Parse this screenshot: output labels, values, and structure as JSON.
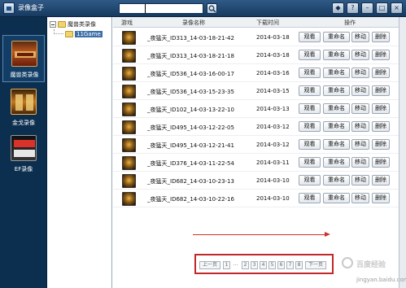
{
  "window": {
    "title": "录像盒子",
    "buttons": [
      "◆",
      "?",
      "–",
      "□",
      "×"
    ]
  },
  "search": {
    "value": ""
  },
  "categories": [
    {
      "label": "魔兽类录像",
      "icon": "warcraft-icon"
    },
    {
      "label": "金戈录像",
      "icon": "jinge-icon"
    },
    {
      "label": "EF录像",
      "icon": "ef-icon"
    }
  ],
  "tree": {
    "root": "魔兽类录像",
    "child": "11Game"
  },
  "table": {
    "headers": {
      "game": "游戏",
      "name": "录像名称",
      "date": "下载时间",
      "actions": "操作"
    },
    "action_labels": {
      "watch": "观看",
      "rename": "重命名",
      "move": "移动",
      "delete": "删除"
    },
    "rows": [
      {
        "name": "_夜猛天_ID313_14-03-18-21-42",
        "date": "2014-03-18"
      },
      {
        "name": "_夜猛天_ID313_14-03-18-21-18",
        "date": "2014-03-18"
      },
      {
        "name": "_夜猛天_ID536_14-03-16-00-17",
        "date": "2014-03-16"
      },
      {
        "name": "_夜猛天_ID536_14-03-15-23-35",
        "date": "2014-03-15"
      },
      {
        "name": "_夜猛天_ID102_14-03-13-22-10",
        "date": "2014-03-13"
      },
      {
        "name": "_夜猛天_ID495_14-03-12-22-05",
        "date": "2014-03-12"
      },
      {
        "name": "_夜猛天_ID495_14-03-12-21-41",
        "date": "2014-03-12"
      },
      {
        "name": "_夜猛天_ID376_14-03-11-22-54",
        "date": "2014-03-11"
      },
      {
        "name": "_夜猛天_ID682_14-03-10-23-13",
        "date": "2014-03-10"
      },
      {
        "name": "_夜猛天_ID682_14-03-10-22-16",
        "date": "2014-03-10"
      }
    ]
  },
  "pager": {
    "prev": "上一页",
    "pages": [
      "1",
      "...",
      "2",
      "3",
      "4",
      "5",
      "6",
      "7",
      "8"
    ],
    "next": "下一页"
  },
  "watermark": {
    "text": "jingyan.baidu.com",
    "brand": "百度经验"
  },
  "colors": {
    "titlebar": "#173a60",
    "sidebar": "#0c2f4f",
    "annotation": "#c32626"
  }
}
